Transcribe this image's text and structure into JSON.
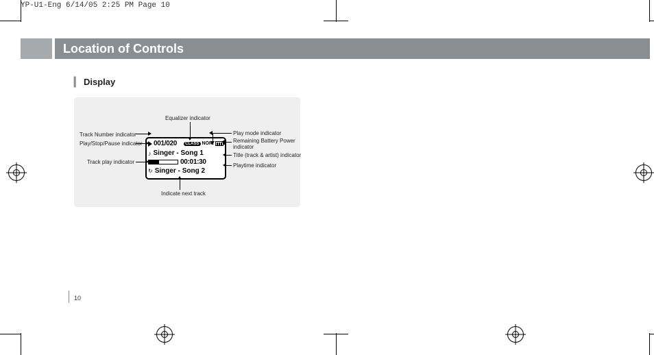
{
  "header_info": "YP-U1-Eng  6/14/05 2:25 PM  Page 10",
  "title": "Location of Controls",
  "section": "Display",
  "page_number": "10",
  "lcd": {
    "track_number": "001/020",
    "eq_badge": "CLASS",
    "mode": "NOR.",
    "title_line": "Singer - Song 1",
    "playtime": "00:01:30",
    "next_track": "Singer - Song 2"
  },
  "callouts": {
    "equalizer": "Equalizer indicator",
    "track_number": "Track Number indicator",
    "play_stop_pause": "Play/Stop/Pause indicator",
    "track_play": "Track play indicator",
    "indicate_next": "Indicate next track",
    "play_mode": "Play mode indicator",
    "battery": "Remaining Battery Power indicator",
    "title_artist": "Title (track & artist) indicator",
    "playtime": "Playtime indicator"
  }
}
